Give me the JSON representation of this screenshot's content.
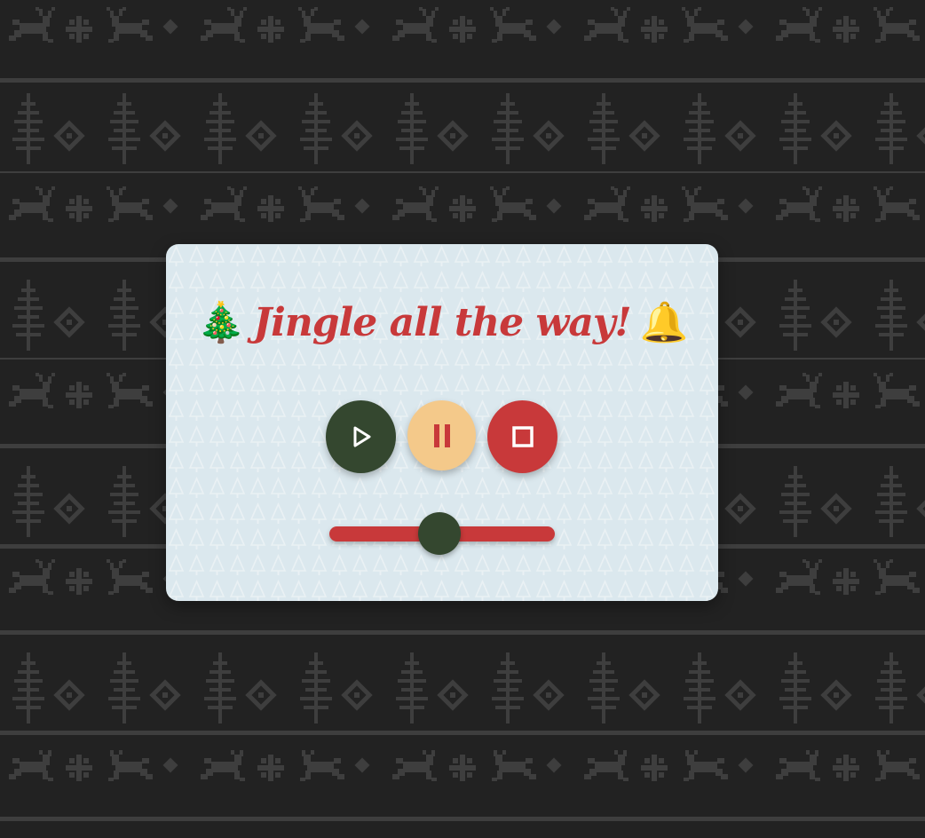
{
  "title": {
    "left_emoji": "🎄",
    "text": "Jingle all the way!",
    "right_emoji": "🔔"
  },
  "controls": {
    "play_icon": "play-icon",
    "pause_icon": "pause-icon",
    "stop_icon": "stop-icon"
  },
  "progress": {
    "fraction": 0.49
  },
  "colors": {
    "background": "#222222",
    "pattern": "#3e3e3e",
    "card": "#dbe8ee",
    "card_pattern": "#eaf1f4",
    "title": "#c8393a",
    "play": "#34472f",
    "pause": "#f4c98a",
    "stop": "#c8393a",
    "slider_track": "#c8393a",
    "slider_thumb": "#34472f",
    "icon_light": "#ffffff"
  }
}
